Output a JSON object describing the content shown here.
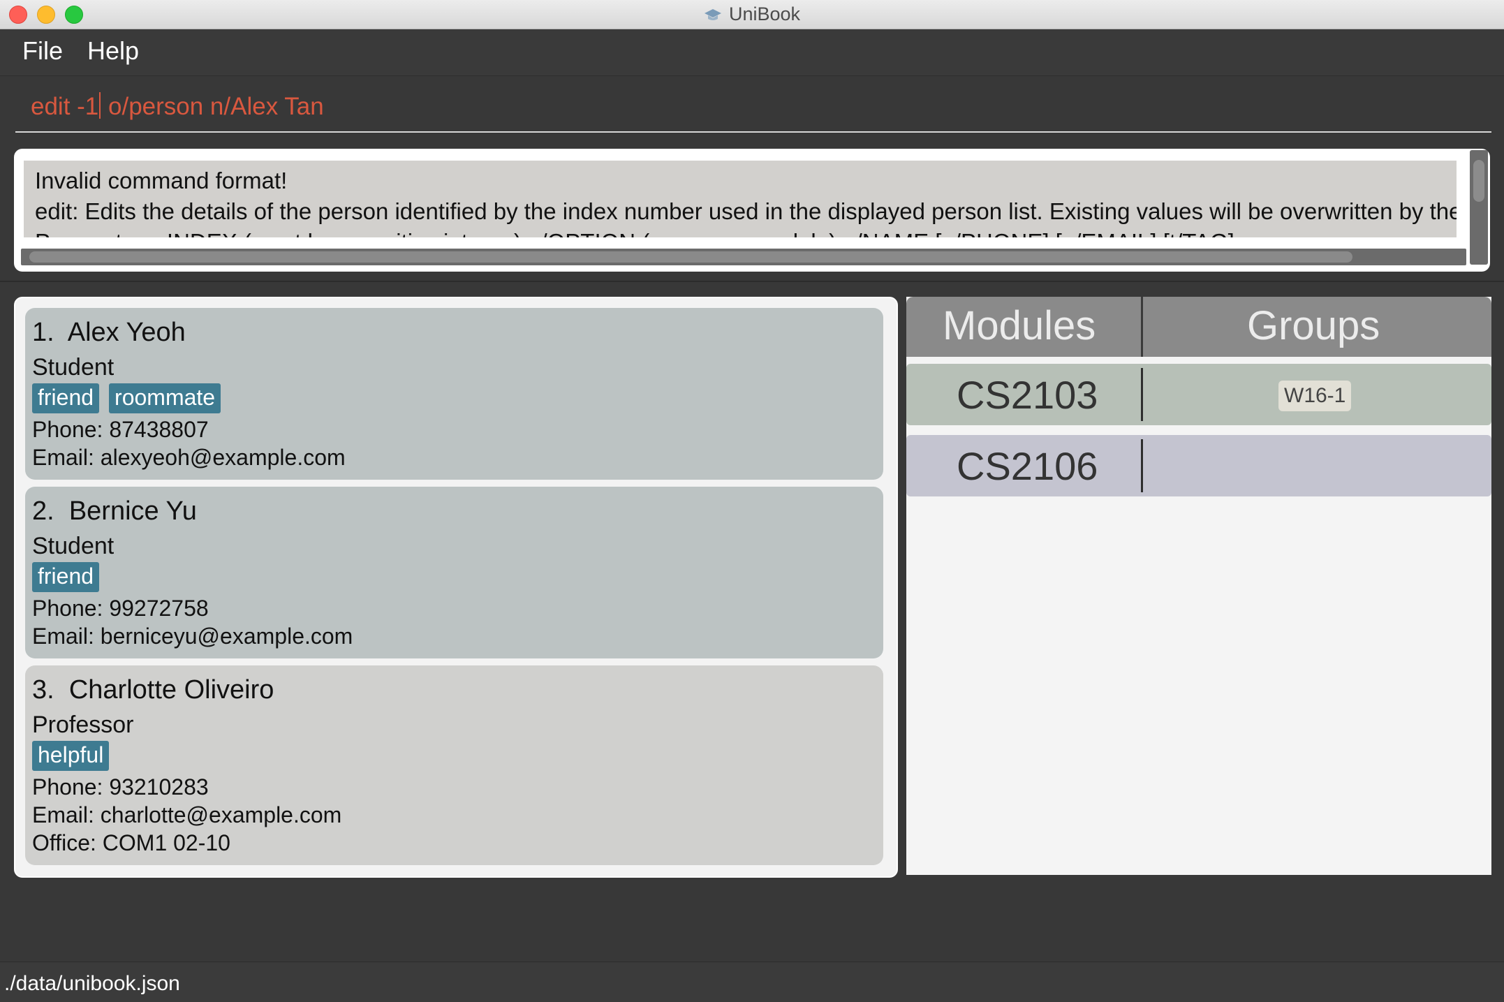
{
  "window": {
    "title": "UniBook"
  },
  "menu": {
    "file": "File",
    "help": "Help"
  },
  "command": {
    "value": "edit -1 o/person n/Alex Tan",
    "before_caret": "edit -1",
    "after_caret": " o/person n/Alex Tan"
  },
  "result": {
    "lines": [
      "Invalid command format!",
      "edit: Edits the details of the person identified by the index number used in the displayed person list. Existing values will be overwritten by the in",
      "Parameters: INDEX (must be a positive integer) o/OPTION (person or module) n/NAME [p/PHONE] [e/EMAIL] [t/TAG]..."
    ]
  },
  "persons": [
    {
      "index": "1.",
      "name": "Alex Yeoh",
      "role": "Student",
      "tags": [
        "friend",
        "roommate"
      ],
      "phone": "Phone: 87438807",
      "email": "Email: alexyeoh@example.com"
    },
    {
      "index": "2.",
      "name": "Bernice Yu",
      "role": "Student",
      "tags": [
        "friend"
      ],
      "phone": "Phone: 99272758",
      "email": "Email: berniceyu@example.com"
    },
    {
      "index": "3.",
      "name": "Charlotte Oliveiro",
      "role": "Professor",
      "tags": [
        "helpful"
      ],
      "phone": "Phone: 93210283",
      "email": "Email: charlotte@example.com",
      "office": "Office: COM1 02-10"
    }
  ],
  "modules": {
    "header_modules": "Modules",
    "header_groups": "Groups",
    "rows": [
      {
        "code": "CS2103",
        "groups": [
          "W16-1"
        ]
      },
      {
        "code": "CS2106",
        "groups": []
      }
    ]
  },
  "status": {
    "path": "./data/unibook.json"
  },
  "colors": {
    "tag": "#3e7b91",
    "command_text": "#d9583f",
    "card_student": "#bcc3c3",
    "card_professor": "#d0d0ce"
  }
}
